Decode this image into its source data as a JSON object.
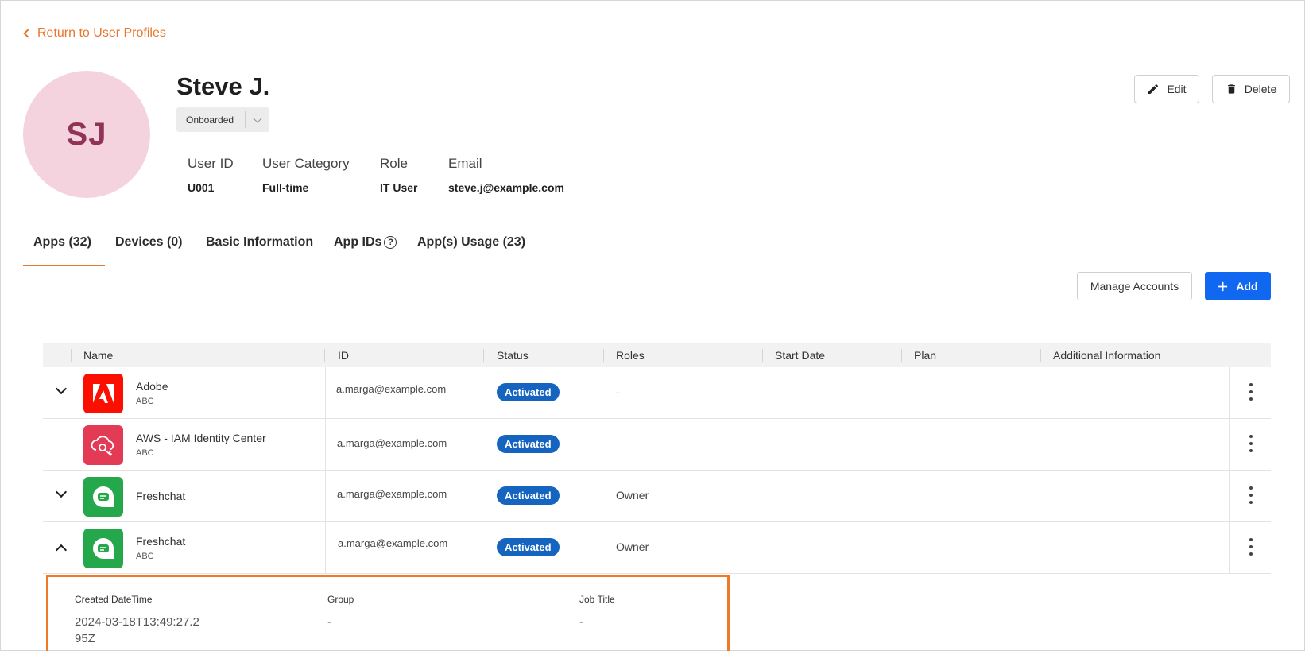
{
  "nav": {
    "back_label": "Return to User Profiles"
  },
  "user": {
    "initials": "SJ",
    "name": "Steve J.",
    "status": "Onboarded",
    "fields": [
      {
        "label": "User ID",
        "value": "U001"
      },
      {
        "label": "User Category",
        "value": "Full-time"
      },
      {
        "label": "Role",
        "value": "IT User"
      },
      {
        "label": "Email",
        "value": "steve.j@example.com"
      }
    ]
  },
  "actions": {
    "edit": "Edit",
    "delete": "Delete",
    "manage_accounts": "Manage Accounts",
    "add": "Add"
  },
  "tabs": [
    {
      "label": "Apps (32)",
      "active": true
    },
    {
      "label": "Devices (0)"
    },
    {
      "label": "Basic Information"
    },
    {
      "label": "App IDs"
    },
    {
      "label": "App(s) Usage (23)"
    }
  ],
  "table": {
    "columns": [
      "Name",
      "ID",
      "Status",
      "Roles",
      "Start Date",
      "Plan",
      "Additional Information"
    ],
    "rows": [
      {
        "name": "Adobe",
        "sub": "ABC",
        "id": "a.marga@example.com",
        "status": "Activated",
        "roles": "-",
        "icon": "adobe-icon",
        "expander": "down"
      },
      {
        "name": "AWS - IAM Identity Center",
        "sub": "ABC",
        "id": "a.marga@example.com",
        "status": "Activated",
        "roles": "",
        "icon": "aws-iam-icon",
        "expander": "none"
      },
      {
        "name": "Freshchat",
        "sub": "",
        "id": "a.marga@example.com",
        "status": "Activated",
        "roles": "Owner",
        "icon": "freshchat-icon",
        "expander": "down"
      },
      {
        "name": "Freshchat",
        "sub": "ABC",
        "id": "a.marga@example.com",
        "status": "Activated",
        "roles": "Owner",
        "icon": "freshchat-icon",
        "expander": "up"
      }
    ]
  },
  "details": [
    {
      "label": "Created DateTime",
      "value": "2024-03-18T13:49:27.295Z"
    },
    {
      "label": "Group",
      "value": "-"
    },
    {
      "label": "Job Title",
      "value": "-"
    }
  ],
  "colors": {
    "accent": "#e8772e",
    "primary": "#1168f0",
    "badge": "#1565c0",
    "avatar_bg": "#f4d3de",
    "adobe": "#fa0f00",
    "aws": "#e33a55",
    "freshchat": "#24a84b"
  }
}
